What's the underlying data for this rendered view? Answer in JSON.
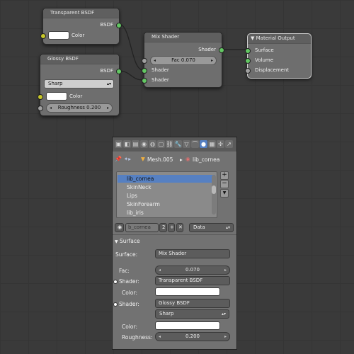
{
  "nodes": {
    "transparent": {
      "title": "Transparent BSDF",
      "out_label": "BSDF",
      "color_label": "Color"
    },
    "glossy": {
      "title": "Glossy BSDF",
      "out_label": "BSDF",
      "distribution": "Sharp",
      "color_label": "Color",
      "roughness": "Roughness 0.200"
    },
    "mix": {
      "title": "Mix Shader",
      "out_label": "Shader",
      "fac": "Fac 0.070",
      "shader1": "Shader",
      "shader2": "Shader"
    },
    "output": {
      "title": "Material Output",
      "surface": "Surface",
      "volume": "Volume",
      "displacement": "Displacement"
    }
  },
  "panel": {
    "context": {
      "object": "Mesh.005",
      "material": "lib_cornea"
    },
    "materials": [
      "lib_cornea",
      "SkinNeck",
      "Lips",
      "SkinForearm",
      "lib_iris"
    ],
    "slot": {
      "name": "b_cornea",
      "users": "2",
      "link": "Data"
    },
    "surface_header": "Surface",
    "surface_label": "Surface:",
    "surface_value": "Mix Shader",
    "fac_label": "Fac:",
    "fac_value": "0.070",
    "shader1_label": "Shader:",
    "shader1_value": "Transparent BSDF",
    "color1_label": "Color:",
    "shader2_label": "Shader:",
    "shader2_value": "Glossy BSDF",
    "distribution": "Sharp",
    "color2_label": "Color:",
    "roughness_label": "Roughness:",
    "roughness_value": "0.200"
  },
  "colors": {
    "socket_shader": "#63c763",
    "socket_color": "#c7c729",
    "socket_value": "#a1a1a1",
    "selection": "#5680c2"
  }
}
